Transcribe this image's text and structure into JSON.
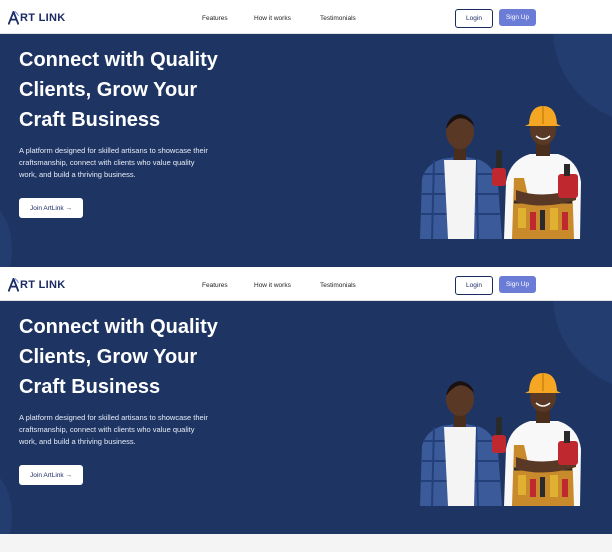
{
  "brand": {
    "name": "RT LINK",
    "initial": "A"
  },
  "nav": {
    "links": [
      "Features",
      "How it works",
      "Testimonials"
    ],
    "login_label": "Login",
    "signup_label": "Sign Up"
  },
  "hero": {
    "title_lines": [
      "Connect with Quality",
      "Clients, Grow Your",
      "Craft Business"
    ],
    "description_lines": [
      "A platform designed for skilled artisans to showcase their",
      "craftsmanship, connect with clients who value quality",
      "work, and build a thriving business."
    ],
    "cta_label": "Join ArtLink →"
  },
  "colors": {
    "hero_bg": "#1e3564",
    "brand_navy": "#1b2b63",
    "signup_bg": "#6b7cd6",
    "helmet": "#f5a623"
  },
  "icons": [
    "logo-a-icon",
    "arrow-right-icon"
  ]
}
